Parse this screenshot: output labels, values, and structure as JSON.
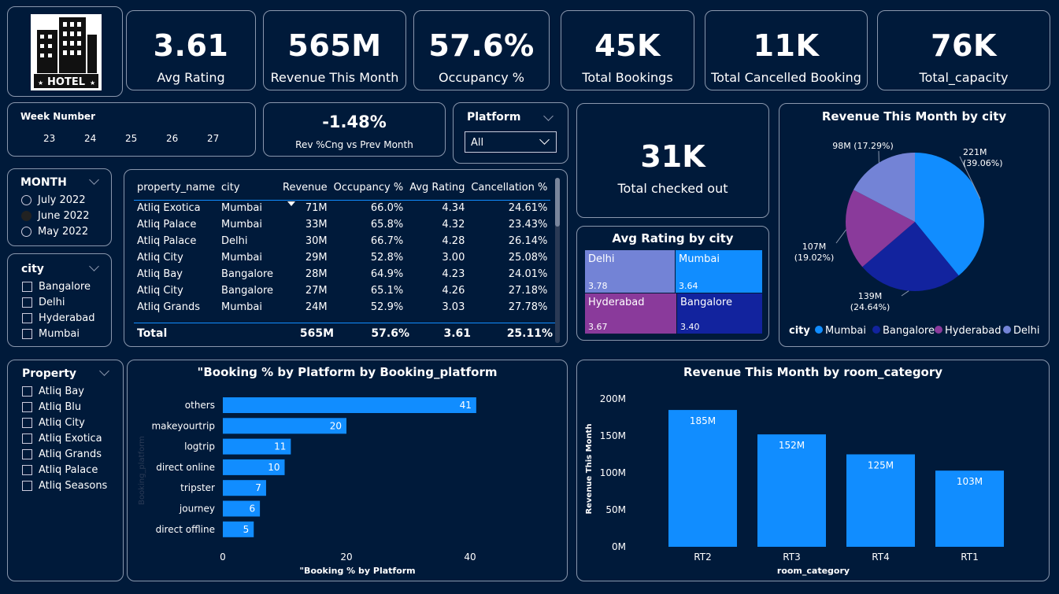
{
  "logo": {
    "text": "HOTEL"
  },
  "kpis": [
    {
      "value": "3.61",
      "label": "Avg Rating"
    },
    {
      "value": "565M",
      "label": "Revenue This Month"
    },
    {
      "value": "57.6%",
      "label": "Occupancy %"
    },
    {
      "value": "45K",
      "label": "Total Bookings"
    },
    {
      "value": "11K",
      "label": "Total Cancelled Booking"
    },
    {
      "value": "76K",
      "label": "Total_capacity"
    }
  ],
  "week_slicer": {
    "title": "Week Number",
    "weeks": [
      "23",
      "24",
      "25",
      "26",
      "27"
    ]
  },
  "rev_change": {
    "value": "-1.48%",
    "label": "Rev %Cng vs Prev Month"
  },
  "platform_slicer": {
    "title": "Platform",
    "selected": "All"
  },
  "checked_out": {
    "value": "31K",
    "label": "Total checked out"
  },
  "month_slicer": {
    "title": "MONTH",
    "options": [
      "July 2022",
      "June 2022",
      "May 2022"
    ],
    "selected": "June 2022"
  },
  "city_slicer": {
    "title": "city",
    "options": [
      "Bangalore",
      "Delhi",
      "Hyderabad",
      "Mumbai"
    ]
  },
  "property_slicer": {
    "title": "Property",
    "options": [
      "Atliq Bay",
      "Atliq Blu",
      "Atliq City",
      "Atliq Exotica",
      "Atliq Grands",
      "Atliq Palace",
      "Atliq Seasons"
    ]
  },
  "table": {
    "columns": [
      "property_name",
      "city",
      "Revenue",
      "Occupancy %",
      "Avg Rating",
      "Cancellation %"
    ],
    "rows": [
      [
        "Atliq Exotica",
        "Mumbai",
        "71M",
        "66.0%",
        "4.34",
        "24.61%"
      ],
      [
        "Atliq Palace",
        "Mumbai",
        "33M",
        "65.8%",
        "4.32",
        "23.43%"
      ],
      [
        "Atliq Palace",
        "Delhi",
        "30M",
        "66.7%",
        "4.28",
        "26.14%"
      ],
      [
        "Atliq City",
        "Mumbai",
        "29M",
        "52.8%",
        "3.00",
        "25.08%"
      ],
      [
        "Atliq Bay",
        "Bangalore",
        "28M",
        "64.9%",
        "4.23",
        "24.01%"
      ],
      [
        "Atliq City",
        "Bangalore",
        "27M",
        "65.1%",
        "4.26",
        "27.18%"
      ],
      [
        "Atliq Grands",
        "Mumbai",
        "24M",
        "52.9%",
        "3.03",
        "27.78%"
      ]
    ],
    "total": [
      "Total",
      "",
      "565M",
      "57.6%",
      "3.61",
      "25.11%"
    ]
  },
  "chart_data": [
    {
      "type": "treemap",
      "title": "Avg Rating by city",
      "categories": [
        "Delhi",
        "Mumbai",
        "Hyderabad",
        "Bangalore"
      ],
      "values": [
        3.78,
        3.64,
        3.67,
        3.4
      ],
      "value_labels": [
        "3.78",
        "3.64",
        "3.67",
        "3.40"
      ],
      "colors": [
        "#7383d6",
        "#118dff",
        "#8a3a9b",
        "#12239e"
      ]
    },
    {
      "type": "pie",
      "title": "Revenue This Month by city",
      "legend_title": "city",
      "legend_placement": "bottom",
      "categories": [
        "Mumbai",
        "Bangalore",
        "Hyderabad",
        "Delhi"
      ],
      "values": [
        221,
        139,
        107,
        98
      ],
      "percents": [
        39.06,
        24.64,
        19.02,
        17.29
      ],
      "labels": [
        "221M",
        "139M",
        "107M",
        "98M"
      ],
      "pct_labels": [
        "(39.06%)",
        "(24.64%)",
        "(19.02%)",
        "(17.29%)"
      ],
      "colors": [
        "#118dff",
        "#12239e",
        "#8a3a9b",
        "#7383d6"
      ]
    },
    {
      "type": "bar",
      "orientation": "horizontal",
      "title": "\"Booking % by Platform by Booking_platform",
      "categories": [
        "others",
        "makeyourtrip",
        "logtrip",
        "direct online",
        "tripster",
        "journey",
        "direct offline"
      ],
      "values": [
        41,
        20,
        11,
        10,
        7,
        6,
        5
      ],
      "xlabel": "\"Booking % by Platform",
      "ylabel": "Booking_platform",
      "xticks": [
        "0",
        "20",
        "40"
      ],
      "xlim": [
        0,
        45
      ],
      "color": "#118dff"
    },
    {
      "type": "bar",
      "title": "Revenue This Month by room_category",
      "categories": [
        "RT2",
        "RT3",
        "RT4",
        "RT1"
      ],
      "values": [
        185,
        152,
        125,
        103
      ],
      "value_labels": [
        "185M",
        "152M",
        "125M",
        "103M"
      ],
      "xlabel": "room_category",
      "ylabel": "Revenue This Month",
      "yticks": [
        "0M",
        "50M",
        "100M",
        "150M",
        "200M"
      ],
      "ylim": [
        0,
        200
      ],
      "color": "#118dff"
    }
  ]
}
